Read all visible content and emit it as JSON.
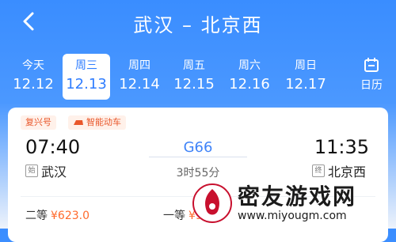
{
  "header": {
    "title": "武汉 – 北京西"
  },
  "dates": [
    {
      "weekday": "今天",
      "date": "12.12",
      "active": false
    },
    {
      "weekday": "周三",
      "date": "12.13",
      "active": true
    },
    {
      "weekday": "周四",
      "date": "12.14",
      "active": false
    },
    {
      "weekday": "周五",
      "date": "12.15",
      "active": false
    },
    {
      "weekday": "周六",
      "date": "12.16",
      "active": false
    },
    {
      "weekday": "周日",
      "date": "12.17",
      "active": false
    }
  ],
  "calendar": {
    "label": "日历",
    "icon": "calendar-icon"
  },
  "card": {
    "badges": [
      "复兴号",
      "智能动车"
    ],
    "departure_time": "07:40",
    "arrival_time": "11:35",
    "train_no": "G66",
    "duration": "3时55分",
    "departure_station": "武汉",
    "departure_tag": "始",
    "arrival_station": "北京西",
    "arrival_tag": "终",
    "seats": [
      {
        "class": "二等",
        "price": "¥623.0"
      },
      {
        "class": "一等",
        "price": "¥9"
      }
    ]
  },
  "watermark": {
    "text": "密友游戏网",
    "url": "www.miyougm.com"
  },
  "colors": {
    "primary_blue": "#3a8dff",
    "accent_orange": "#ff6a2c"
  }
}
